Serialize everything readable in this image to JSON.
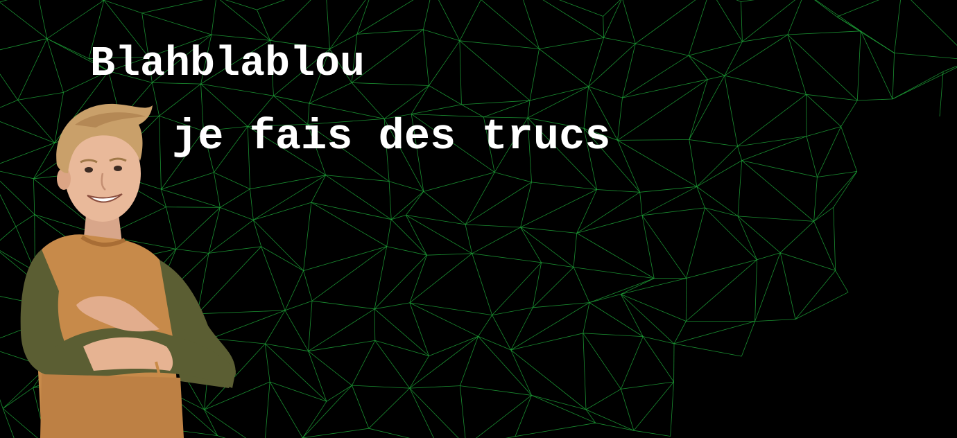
{
  "hero": {
    "title": "Blahblablou",
    "subtitle": "je fais des trucs",
    "portrait_icon": "person-portrait-icon"
  },
  "colors": {
    "background": "#000000",
    "mesh": "#1fa83a",
    "text": "#ffffff",
    "shirt": "#c78a4a",
    "sleeve": "#5b5e33",
    "hair": "#c9a06a",
    "skin": "#e9b99a"
  }
}
